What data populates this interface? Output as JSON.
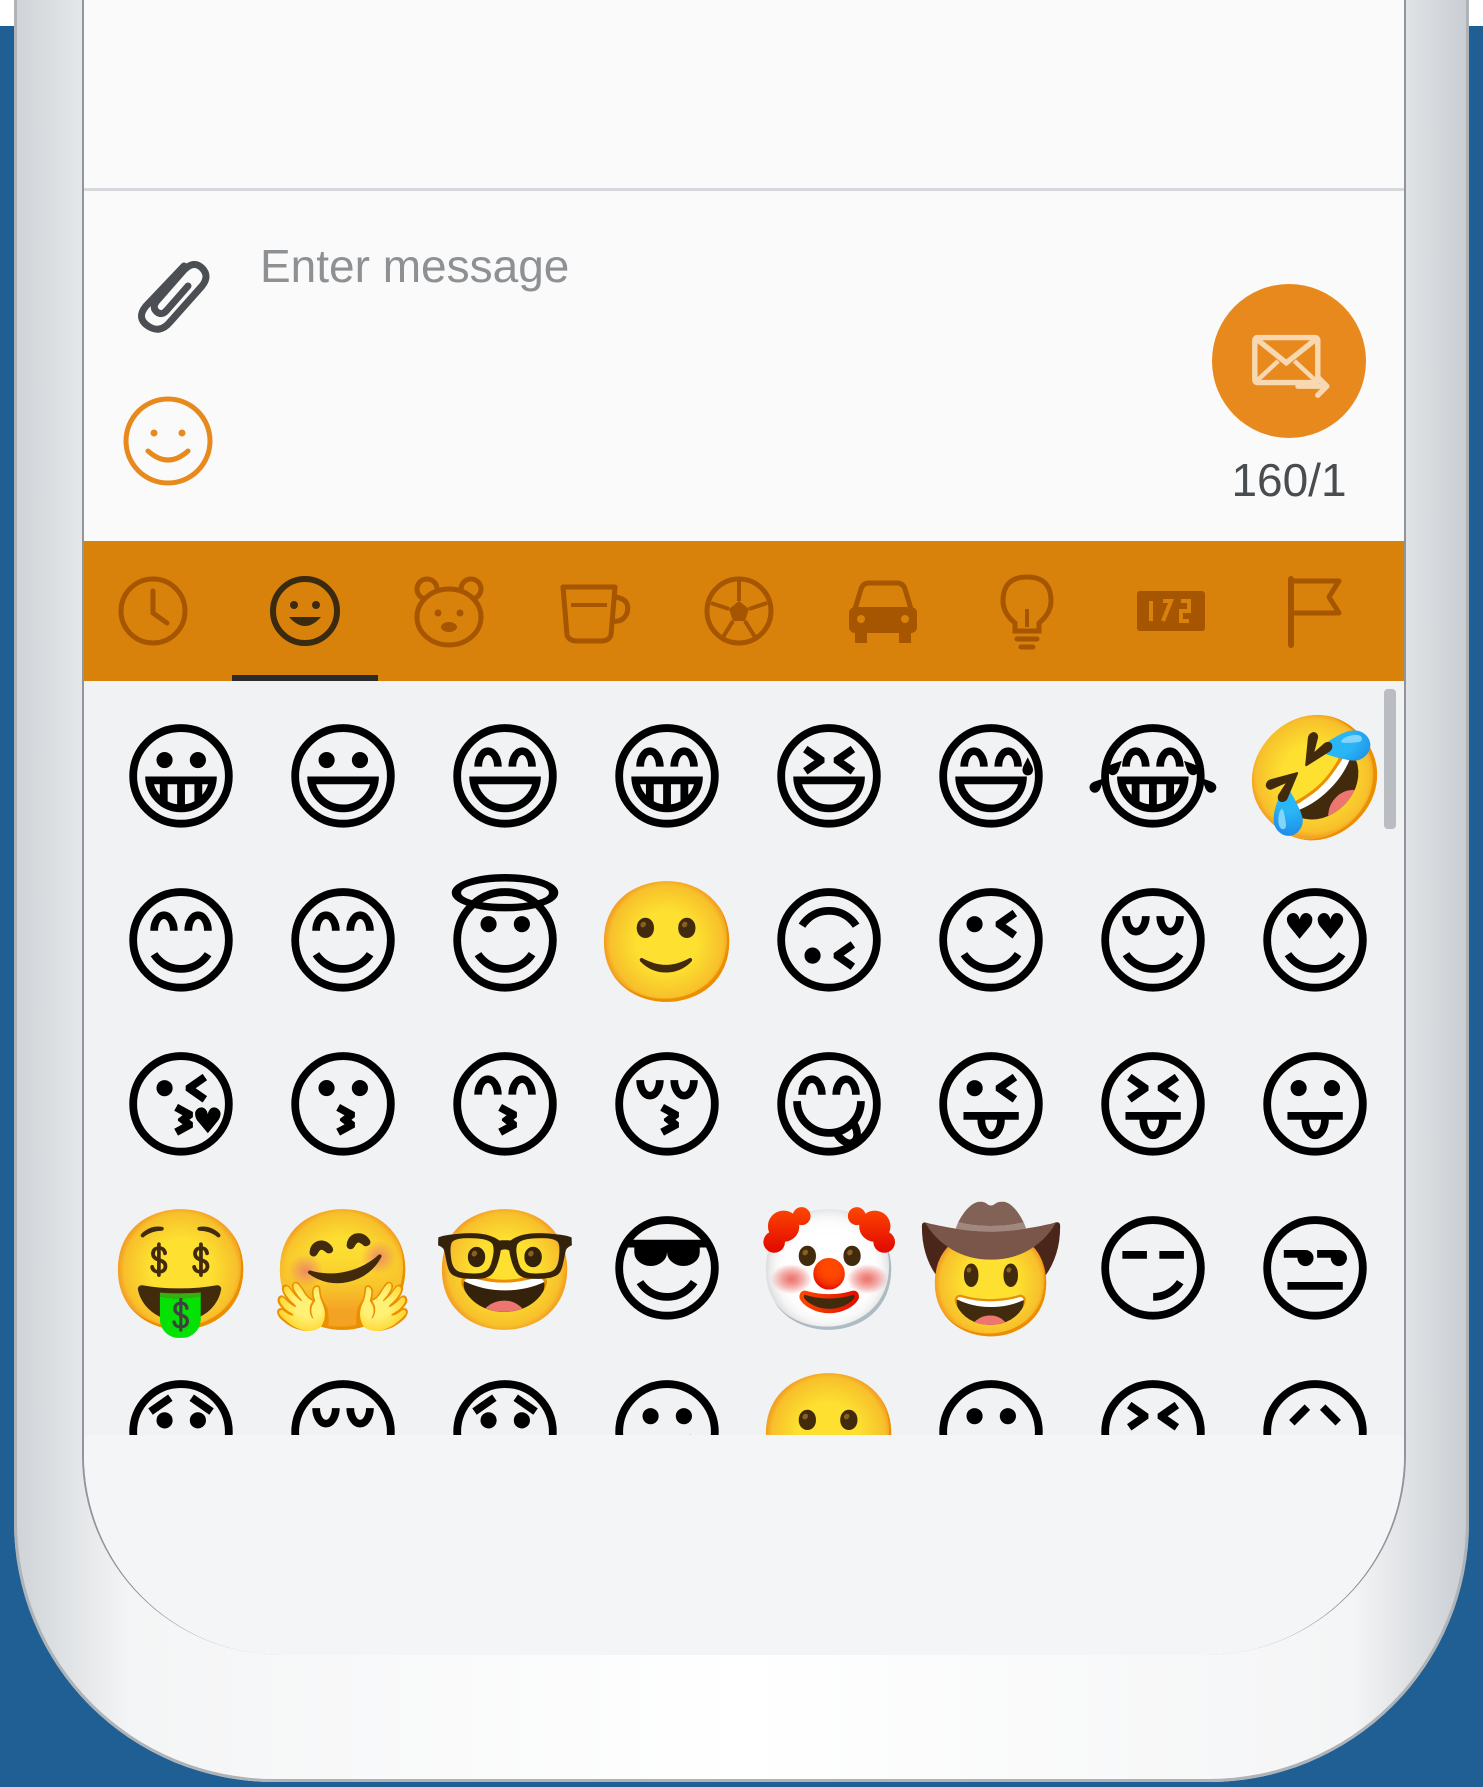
{
  "compose": {
    "placeholder": "Enter message",
    "counter": "160/1",
    "attach_icon": "paperclip-icon",
    "emoji_icon": "smiley-icon",
    "send_icon": "envelope-send-icon"
  },
  "colors": {
    "accent": "#e8891e",
    "category_bar": "#d9820b",
    "category_icon": "#a65500",
    "background": "#1f5f93"
  },
  "emoji_categories": [
    {
      "icon": "clock-icon",
      "name": "recent"
    },
    {
      "icon": "smiley-icon",
      "name": "smileys",
      "selected": true
    },
    {
      "icon": "bear-icon",
      "name": "animals"
    },
    {
      "icon": "cup-icon",
      "name": "food"
    },
    {
      "icon": "soccer-ball-icon",
      "name": "activities"
    },
    {
      "icon": "car-icon",
      "name": "travel"
    },
    {
      "icon": "lightbulb-icon",
      "name": "objects"
    },
    {
      "icon": "symbols-icon",
      "name": "symbols"
    },
    {
      "icon": "flag-icon",
      "name": "flags"
    }
  ],
  "emojis": [
    [
      "😀",
      "😃",
      "😄",
      "😁",
      "😆",
      "😅",
      "😂",
      "🤣"
    ],
    [
      "😊",
      "😊",
      "😇",
      "🙂",
      "🙃",
      "😉",
      "😌",
      "😍"
    ],
    [
      "😘",
      "😗",
      "😙",
      "😚",
      "😋",
      "😜",
      "😝",
      "😛"
    ],
    [
      "🤑",
      "🤗",
      "🤓",
      "😎",
      "🤡",
      "🤠",
      "😏",
      "😒"
    ],
    [
      "😞",
      "😔",
      "😟",
      "😕",
      "🙁",
      "☹",
      "😣",
      "😖"
    ]
  ]
}
